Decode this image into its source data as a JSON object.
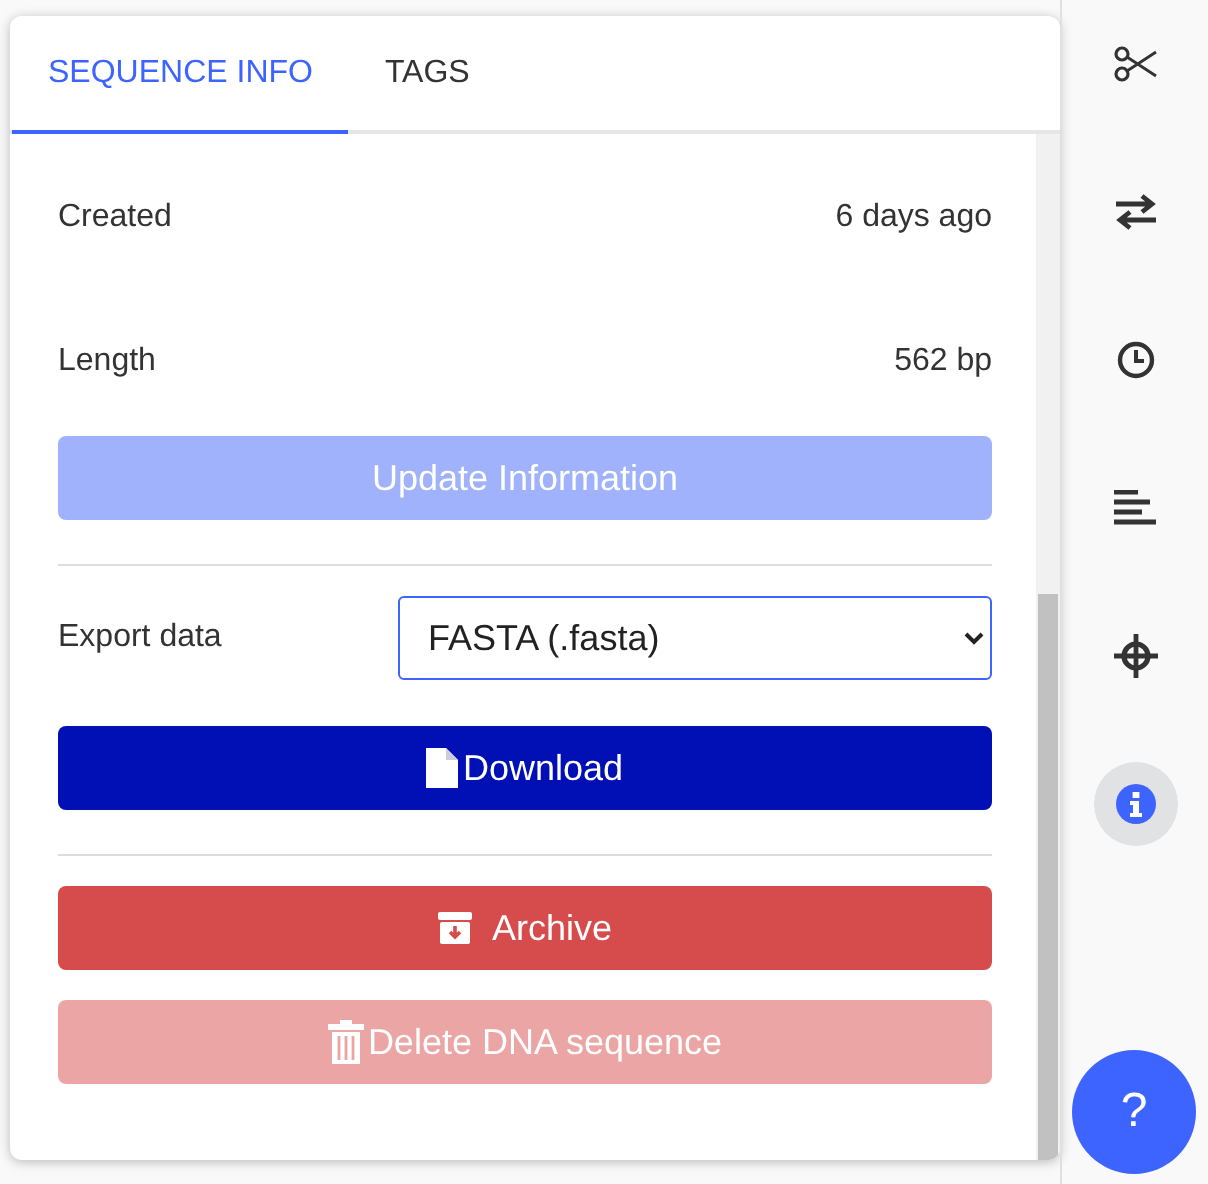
{
  "tabs": [
    {
      "label": "SEQUENCE INFO",
      "selected": true
    },
    {
      "label": "TAGS",
      "selected": false
    }
  ],
  "info": [
    {
      "label": "Created",
      "value": "6 days ago"
    },
    {
      "label": "Length",
      "value": "562 bp"
    }
  ],
  "update_button": {
    "label": "Update Information",
    "disabled": true
  },
  "export": {
    "label": "Export data",
    "value": "FASTA (.fasta)"
  },
  "download_button": {
    "label": "Download"
  },
  "archive_button": {
    "label": "Archive"
  },
  "delete_button": {
    "label": "Delete DNA sequence",
    "disabled": true
  },
  "toolbar": [
    {
      "kind": "scissors",
      "selected": false
    },
    {
      "kind": "swap",
      "selected": false
    },
    {
      "kind": "clock",
      "selected": false
    },
    {
      "kind": "align",
      "selected": false
    },
    {
      "kind": "crosshair",
      "selected": false
    },
    {
      "kind": "info",
      "selected": true
    }
  ],
  "help_button": {
    "label": "?"
  }
}
